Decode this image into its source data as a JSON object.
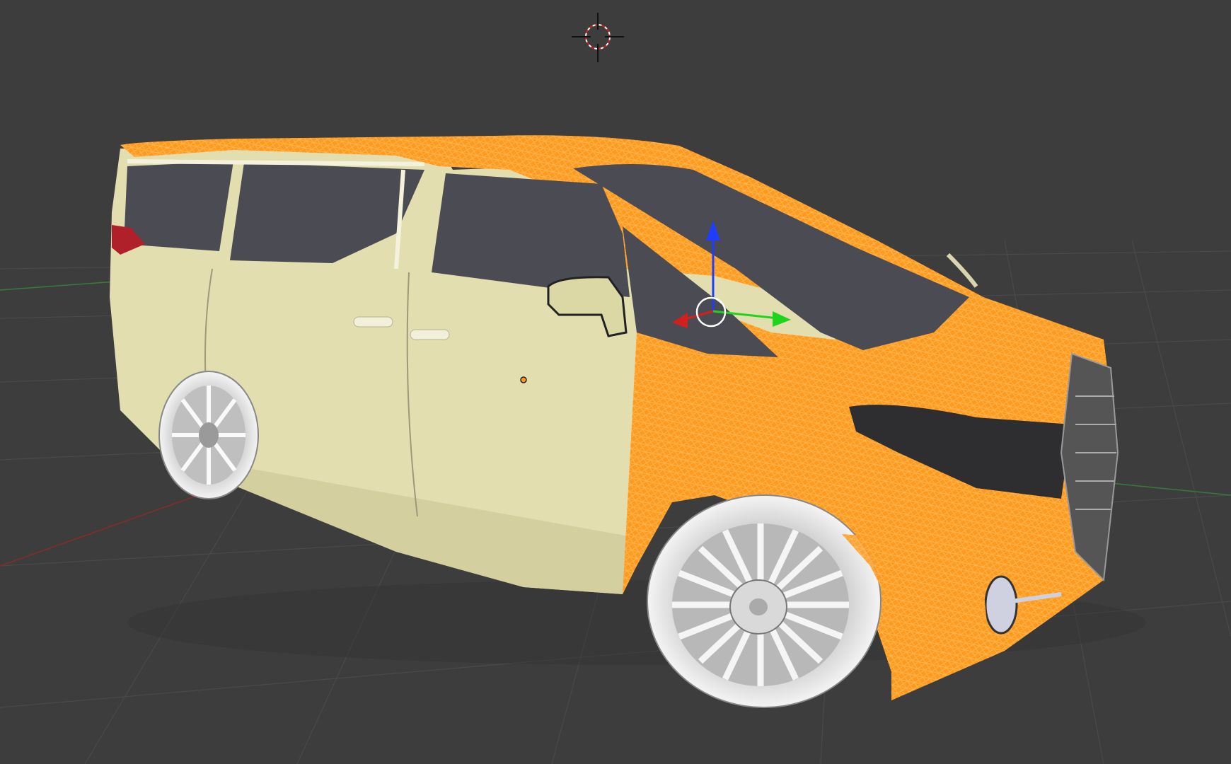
{
  "app": {
    "name": "3D viewport",
    "background_color": "#3d3d3d"
  },
  "viewport": {
    "scene": "minivan-model",
    "mesh_colors": {
      "body_paint": "#e2deb0",
      "selected_mesh": "#ff9a1f",
      "selected_wire": "#ffb04a",
      "glass": "#4a4b52",
      "tire": "#eeeeee",
      "rim": "#c8c8c8",
      "taillight": "#b0202a",
      "grille": "#2e2e30"
    },
    "grid": {
      "visible": true,
      "line_color": "#4a4a4a",
      "x_axis_color": "#8a2a2a",
      "y_axis_color": "#3a7a3a"
    },
    "gizmo": {
      "z_axis_color": "#1f3cff",
      "y_axis_color": "#1fd41f",
      "x_axis_color": "#d41f1f",
      "pivot_color": "#ffffff"
    },
    "cursor_icon": "3d-cursor-icon",
    "origin_icon": "object-origin-icon"
  }
}
